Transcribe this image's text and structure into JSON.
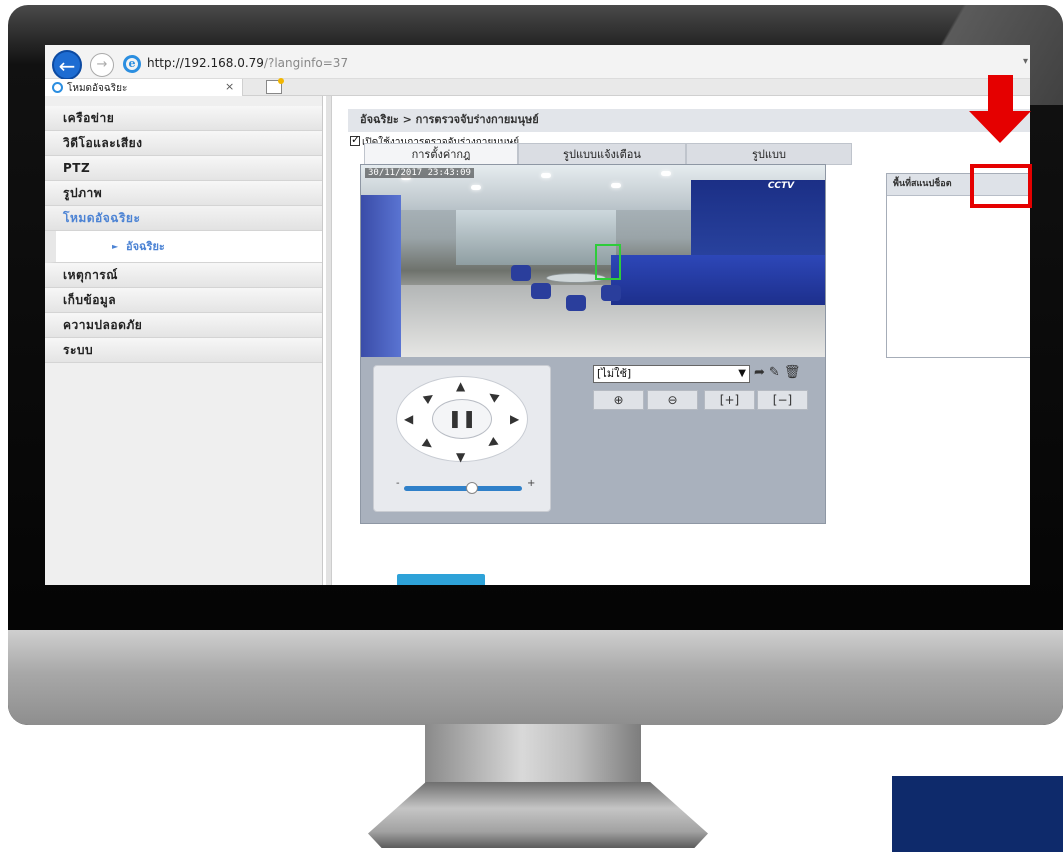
{
  "browser": {
    "url_prefix": "http://192.168.0.79",
    "url_suffix": "/?langinfo=37",
    "tab_title": "โหมดอัจฉริยะ",
    "tab_close": "×",
    "back_icon": "arrow-left-icon",
    "forward_icon": "arrow-right-icon"
  },
  "sidebar": {
    "items": [
      {
        "label": "เครือข่าย"
      },
      {
        "label": "วิดีโอและเสียง"
      },
      {
        "label": "PTZ"
      },
      {
        "label": "รูปภาพ"
      },
      {
        "label": "โหมดอัจฉริยะ",
        "active": true
      },
      {
        "label": "เหตุการณ์"
      },
      {
        "label": "เก็บข้อมูล"
      },
      {
        "label": "ความปลอดภัย"
      },
      {
        "label": "ระบบ"
      }
    ],
    "sub_item": "อัจฉริยะ"
  },
  "content": {
    "breadcrumb": "อัจฉริยะ > การตรวจจับร่างกายมนุษย์",
    "enable_label": "เปิดใช้งานการตรวจจับร่างกายมนุษย์",
    "enable_checked": true,
    "tabs": [
      "การตั้งค่ากฎ",
      "รูปแบบแจ้งเตือน",
      "รูปแบบ"
    ],
    "active_tab": 0,
    "video": {
      "timestamp": "30/11/2017 23:43:09",
      "sign_text": "CCTV"
    },
    "ptz": {
      "pause_symbol": "❚❚",
      "slider_min": "-",
      "slider_max": "+",
      "zoom_level": 0.5
    },
    "preset": {
      "value": "[ไม่ใช้]",
      "icons": [
        "call-preset-icon",
        "edit-icon",
        "delete-icon"
      ]
    },
    "zoom_buttons": [
      "⊕",
      "⊖",
      "[+]",
      "[−]"
    ],
    "area_panel": {
      "title": "พื้นที่สแนปช็อต",
      "add_symbol": "+"
    }
  },
  "colors": {
    "accent": "#4c83d4",
    "annotation": "#e50000",
    "detection_box": "#2ecc3a",
    "brand_block": "#0e2a6b"
  }
}
